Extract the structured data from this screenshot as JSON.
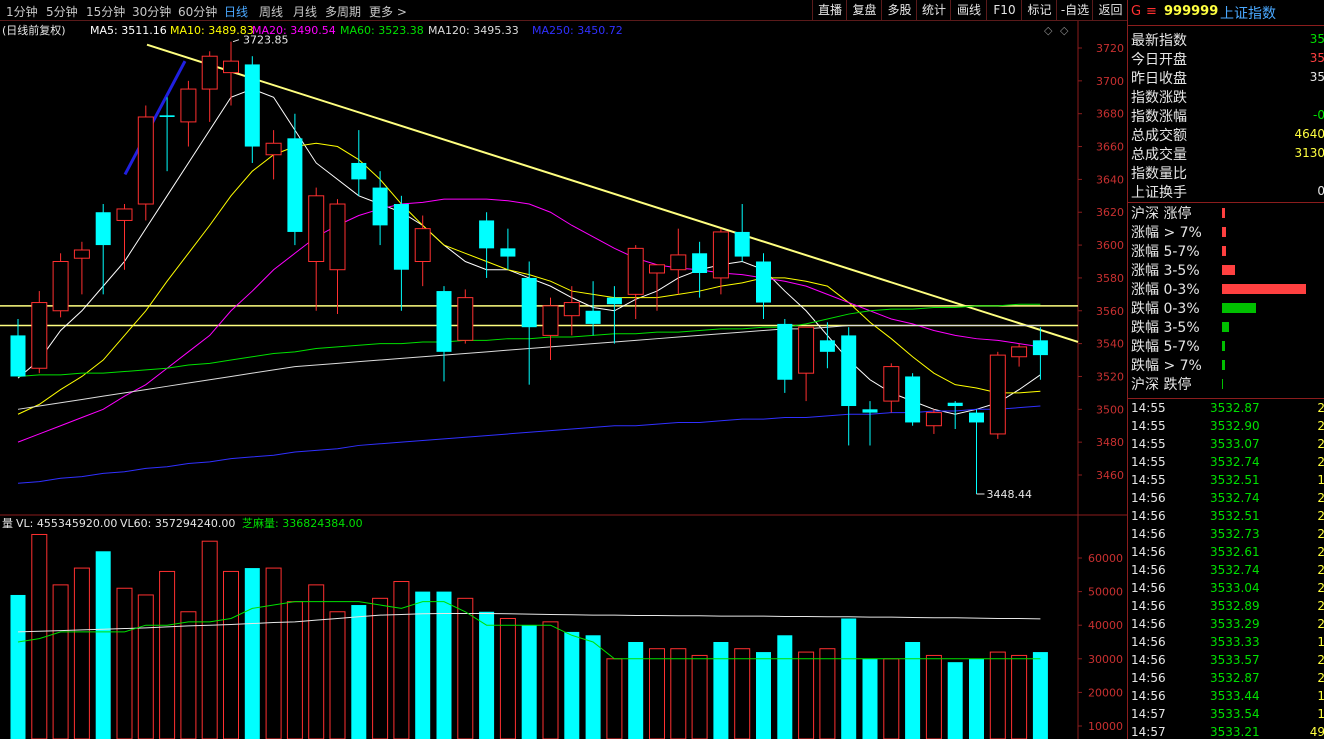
{
  "toolbar": {
    "periods": [
      "1分钟",
      "5分钟",
      "15分钟",
      "30分钟",
      "60分钟",
      "日线",
      "周线",
      "月线",
      "多周期",
      "更多 >"
    ],
    "active_period": "日线",
    "buttons": [
      "直播",
      "复盘",
      "多股",
      "统计",
      "画线",
      "F10",
      "标记",
      "-自选",
      "返回"
    ]
  },
  "ma_legend": {
    "mode": "(日线前复权)",
    "items": [
      {
        "text": "MA5: 3511.16",
        "color": "#ffffff"
      },
      {
        "text": "MA10: 3489.83",
        "color": "#ffff00"
      },
      {
        "text": "MA20: 3490.54",
        "color": "#ff00ff"
      },
      {
        "text": "MA60: 3523.38",
        "color": "#00e000"
      },
      {
        "text": "MA120: 3495.33",
        "color": "#dcdcdc"
      },
      {
        "text": "MA250: 3450.72",
        "color": "#3030ff"
      }
    ]
  },
  "volume_legend": {
    "title": "量",
    "items": [
      {
        "text": "VL: 455345920.00",
        "color": "#e6e6e6"
      },
      {
        "text": "VL60: 357294240.00",
        "color": "#e6e6e6"
      },
      {
        "text": "芝麻量: 336824384.00",
        "color": "#00e000"
      }
    ]
  },
  "chart_data": {
    "type": "candlestick",
    "price_axis": {
      "ticks": [
        3460,
        3480,
        3500,
        3520,
        3540,
        3560,
        3580,
        3600,
        3620,
        3640,
        3660,
        3680,
        3700,
        3720
      ]
    },
    "volume_axis": {
      "ticks": [
        10000,
        20000,
        30000,
        40000,
        50000,
        60000
      ]
    },
    "annotations": {
      "high_label": "3723.85",
      "low_label": "3448.44"
    },
    "candles": [
      {
        "o": 3545,
        "h": 3555,
        "l": 3525,
        "c": 3520
      },
      {
        "o": 3525,
        "h": 3572,
        "l": 3522,
        "c": 3565
      },
      {
        "o": 3560,
        "h": 3595,
        "l": 3556,
        "c": 3590
      },
      {
        "o": 3592,
        "h": 3602,
        "l": 3570,
        "c": 3597
      },
      {
        "o": 3620,
        "h": 3625,
        "l": 3570,
        "c": 3600
      },
      {
        "o": 3615,
        "h": 3625,
        "l": 3585,
        "c": 3622
      },
      {
        "o": 3625,
        "h": 3685,
        "l": 3615,
        "c": 3678
      },
      {
        "o": 3679,
        "h": 3690,
        "l": 3645,
        "c": 3678
      },
      {
        "o": 3675,
        "h": 3700,
        "l": 3660,
        "c": 3695
      },
      {
        "o": 3695,
        "h": 3718,
        "l": 3675,
        "c": 3715
      },
      {
        "o": 3705,
        "h": 3723.85,
        "l": 3685,
        "c": 3712
      },
      {
        "o": 3710,
        "h": 3715,
        "l": 3650,
        "c": 3660
      },
      {
        "o": 3655,
        "h": 3670,
        "l": 3640,
        "c": 3662
      },
      {
        "o": 3665,
        "h": 3680,
        "l": 3600,
        "c": 3608
      },
      {
        "o": 3590,
        "h": 3635,
        "l": 3560,
        "c": 3630
      },
      {
        "o": 3585,
        "h": 3628,
        "l": 3558,
        "c": 3625
      },
      {
        "o": 3650,
        "h": 3670,
        "l": 3630,
        "c": 3640
      },
      {
        "o": 3635,
        "h": 3645,
        "l": 3600,
        "c": 3612
      },
      {
        "o": 3625,
        "h": 3630,
        "l": 3560,
        "c": 3585
      },
      {
        "o": 3590,
        "h": 3618,
        "l": 3575,
        "c": 3610
      },
      {
        "o": 3572,
        "h": 3575,
        "l": 3517,
        "c": 3535
      },
      {
        "o": 3542,
        "h": 3573,
        "l": 3540,
        "c": 3568
      },
      {
        "o": 3615,
        "h": 3620,
        "l": 3580,
        "c": 3598
      },
      {
        "o": 3598,
        "h": 3610,
        "l": 3585,
        "c": 3593
      },
      {
        "o": 3580,
        "h": 3590,
        "l": 3515,
        "c": 3550
      },
      {
        "o": 3545,
        "h": 3568,
        "l": 3530,
        "c": 3563
      },
      {
        "o": 3557,
        "h": 3575,
        "l": 3545,
        "c": 3565
      },
      {
        "o": 3560,
        "h": 3578,
        "l": 3545,
        "c": 3552
      },
      {
        "o": 3568,
        "h": 3575,
        "l": 3540,
        "c": 3564
      },
      {
        "o": 3570,
        "h": 3600,
        "l": 3555,
        "c": 3598
      },
      {
        "o": 3583,
        "h": 3585,
        "l": 3560,
        "c": 3588
      },
      {
        "o": 3585,
        "h": 3610,
        "l": 3570,
        "c": 3594
      },
      {
        "o": 3595,
        "h": 3602,
        "l": 3568,
        "c": 3583
      },
      {
        "o": 3580,
        "h": 3610,
        "l": 3570,
        "c": 3608
      },
      {
        "o": 3608,
        "h": 3625,
        "l": 3590,
        "c": 3593
      },
      {
        "o": 3590,
        "h": 3595,
        "l": 3555,
        "c": 3565
      },
      {
        "o": 3552,
        "h": 3555,
        "l": 3510,
        "c": 3518
      },
      {
        "o": 3522,
        "h": 3550,
        "l": 3505,
        "c": 3550
      },
      {
        "o": 3542,
        "h": 3553,
        "l": 3525,
        "c": 3535
      },
      {
        "o": 3545,
        "h": 3550,
        "l": 3478,
        "c": 3502
      },
      {
        "o": 3500,
        "h": 3505,
        "l": 3478,
        "c": 3498
      },
      {
        "o": 3505,
        "h": 3528,
        "l": 3498,
        "c": 3526
      },
      {
        "o": 3520,
        "h": 3522,
        "l": 3490,
        "c": 3492
      },
      {
        "o": 3490,
        "h": 3500,
        "l": 3485,
        "c": 3498
      },
      {
        "o": 3504,
        "h": 3505,
        "l": 3488,
        "c": 3502
      },
      {
        "o": 3498,
        "h": 3500,
        "l": 3448.44,
        "c": 3492
      },
      {
        "o": 3485,
        "h": 3535,
        "l": 3482,
        "c": 3533
      },
      {
        "o": 3532,
        "h": 3540,
        "l": 3526,
        "c": 3538
      },
      {
        "o": 3542,
        "h": 3550,
        "l": 3518,
        "c": 3533
      }
    ],
    "volumes": [
      {
        "v": 49000,
        "up": false
      },
      {
        "v": 67000,
        "up": true
      },
      {
        "v": 52000,
        "up": true
      },
      {
        "v": 57000,
        "up": true
      },
      {
        "v": 62000,
        "up": false
      },
      {
        "v": 51000,
        "up": true
      },
      {
        "v": 49000,
        "up": true
      },
      {
        "v": 56000,
        "up": true
      },
      {
        "v": 44000,
        "up": true
      },
      {
        "v": 65000,
        "up": true
      },
      {
        "v": 56000,
        "up": true
      },
      {
        "v": 57000,
        "up": false
      },
      {
        "v": 57000,
        "up": true
      },
      {
        "v": 47000,
        "up": true
      },
      {
        "v": 52000,
        "up": true
      },
      {
        "v": 44000,
        "up": true
      },
      {
        "v": 46000,
        "up": false
      },
      {
        "v": 48000,
        "up": true
      },
      {
        "v": 53000,
        "up": true
      },
      {
        "v": 50000,
        "up": false
      },
      {
        "v": 50000,
        "up": false
      },
      {
        "v": 48000,
        "up": true
      },
      {
        "v": 44000,
        "up": false
      },
      {
        "v": 42000,
        "up": true
      },
      {
        "v": 40000,
        "up": false
      },
      {
        "v": 41000,
        "up": true
      },
      {
        "v": 38000,
        "up": false
      },
      {
        "v": 37000,
        "up": false
      },
      {
        "v": 30000,
        "up": true
      },
      {
        "v": 35000,
        "up": false
      },
      {
        "v": 33000,
        "up": true
      },
      {
        "v": 33000,
        "up": true
      },
      {
        "v": 31000,
        "up": true
      },
      {
        "v": 35000,
        "up": false
      },
      {
        "v": 33000,
        "up": true
      },
      {
        "v": 32000,
        "up": false
      },
      {
        "v": 37000,
        "up": false
      },
      {
        "v": 32000,
        "up": true
      },
      {
        "v": 33000,
        "up": true
      },
      {
        "v": 42000,
        "up": false
      },
      {
        "v": 30000,
        "up": false
      },
      {
        "v": 30000,
        "up": true
      },
      {
        "v": 35000,
        "up": false
      },
      {
        "v": 31000,
        "up": true
      },
      {
        "v": 29000,
        "up": false
      },
      {
        "v": 30000,
        "up": false
      },
      {
        "v": 32000,
        "up": true
      },
      {
        "v": 31000,
        "up": true
      },
      {
        "v": 32000,
        "up": false
      }
    ],
    "ma_lines": {
      "MA5": [
        3519,
        3530,
        3548,
        3560,
        3575,
        3590,
        3610,
        3630,
        3650,
        3670,
        3690,
        3695,
        3690,
        3670,
        3650,
        3640,
        3630,
        3625,
        3620,
        3612,
        3600,
        3590,
        3585,
        3585,
        3580,
        3575,
        3568,
        3562,
        3560,
        3567,
        3572,
        3580,
        3585,
        3588,
        3590,
        3585,
        3572,
        3560,
        3545,
        3530,
        3518,
        3510,
        3505,
        3500,
        3497,
        3500,
        3504,
        3512,
        3521
      ],
      "MA10": [
        3497,
        3503,
        3512,
        3520,
        3530,
        3545,
        3560,
        3578,
        3595,
        3612,
        3630,
        3645,
        3655,
        3660,
        3662,
        3660,
        3652,
        3640,
        3625,
        3612,
        3600,
        3595,
        3590,
        3585,
        3582,
        3578,
        3572,
        3570,
        3568,
        3568,
        3568,
        3570,
        3572,
        3575,
        3577,
        3580,
        3580,
        3578,
        3575,
        3565,
        3553,
        3543,
        3532,
        3522,
        3515,
        3513,
        3510,
        3510,
        3511
      ],
      "MA20": [
        3480,
        3485,
        3490,
        3495,
        3500,
        3508,
        3515,
        3525,
        3535,
        3545,
        3560,
        3572,
        3585,
        3595,
        3605,
        3612,
        3618,
        3622,
        3625,
        3626,
        3628,
        3628,
        3628,
        3627,
        3625,
        3620,
        3612,
        3605,
        3598,
        3592,
        3588,
        3586,
        3585,
        3583,
        3582,
        3580,
        3578,
        3575,
        3570,
        3565,
        3560,
        3555,
        3552,
        3548,
        3545,
        3543,
        3542,
        3540,
        3538
      ],
      "MA60": [
        3520,
        3521,
        3521,
        3522,
        3522,
        3523,
        3524,
        3525,
        3527,
        3528,
        3530,
        3532,
        3534,
        3535,
        3537,
        3538,
        3539,
        3540,
        3540,
        3541,
        3541,
        3542,
        3542,
        3543,
        3543,
        3544,
        3544,
        3545,
        3546,
        3546,
        3547,
        3547,
        3548,
        3549,
        3549,
        3550,
        3550,
        3552,
        3555,
        3558,
        3560,
        3561,
        3561,
        3562,
        3562,
        3563,
        3563,
        3564,
        3564
      ],
      "MA120": [
        3500,
        3502,
        3504,
        3506,
        3508,
        3510,
        3512,
        3514,
        3516,
        3518,
        3520,
        3522,
        3524,
        3526,
        3527,
        3528,
        3529,
        3530,
        3531,
        3532,
        3533,
        3534,
        3535,
        3536,
        3537,
        3538,
        3539,
        3540,
        3541,
        3542,
        3543,
        3544,
        3545,
        3546,
        3547,
        3548,
        3549,
        3549,
        3550,
        3551,
        3551,
        3551,
        3551,
        3551,
        3551,
        3551,
        3551,
        3551,
        3551
      ],
      "MA250": [
        3455,
        3456,
        3458,
        3459,
        3461,
        3462,
        3464,
        3465,
        3467,
        3468,
        3470,
        3471,
        3472,
        3474,
        3475,
        3476,
        3478,
        3479,
        3480,
        3481,
        3482,
        3483,
        3484,
        3485,
        3486,
        3487,
        3488,
        3489,
        3490,
        3490,
        3491,
        3492,
        3492,
        3493,
        3494,
        3494,
        3495,
        3495,
        3496,
        3497,
        3497,
        3498,
        3498,
        3499,
        3499,
        3500,
        3500,
        3501,
        3502
      ]
    },
    "volume_ma": {
      "VL60": [
        38000,
        38200,
        38400,
        38600,
        38800,
        39000,
        39200,
        39500,
        39800,
        40000,
        40200,
        40500,
        40800,
        41000,
        41500,
        42000,
        42500,
        43000,
        43200,
        43400,
        43500,
        43500,
        43500,
        43400,
        43300,
        43200,
        43100,
        43000,
        43000,
        42900,
        42900,
        42800,
        42800,
        42700,
        42700,
        42700,
        42600,
        42600,
        42500,
        42500,
        42400,
        42400,
        42300,
        42200,
        42200,
        42100,
        42000,
        42000,
        41900
      ],
      "芝麻量": [
        35000,
        36000,
        38000,
        38000,
        38000,
        38000,
        40000,
        40000,
        41000,
        41000,
        42000,
        45000,
        46000,
        47000,
        47000,
        47000,
        47000,
        46000,
        45000,
        47000,
        47000,
        44000,
        40000,
        40000,
        40000,
        40000,
        37000,
        35000,
        30000,
        30000,
        30000,
        30000,
        30000,
        30000,
        30000,
        30000,
        30000,
        30000,
        30000,
        30000,
        30000,
        30000,
        30000,
        30000,
        30000,
        30000,
        30000,
        30000,
        30000
      ]
    }
  },
  "sidebar": {
    "code": "999999",
    "name": "上证指数",
    "flag": "G",
    "menu_icon": "menu-icon",
    "quotes": [
      {
        "label": "最新指数",
        "value": "35",
        "color": "#00e000"
      },
      {
        "label": "今日开盘",
        "value": "35",
        "color": "#ff4040"
      },
      {
        "label": "昨日收盘",
        "value": "35",
        "color": "#e6e6e6"
      },
      {
        "label": "指数涨跌",
        "value": "",
        "color": "#00e000"
      },
      {
        "label": "指数涨幅",
        "value": "-0",
        "color": "#00e000"
      },
      {
        "label": "总成交额",
        "value": "4640",
        "color": "#ffff40"
      },
      {
        "label": "总成交量",
        "value": "3130",
        "color": "#ffff40"
      },
      {
        "label": "指数量比",
        "value": "",
        "color": "#e6e6e6"
      },
      {
        "label": "上证换手",
        "value": "0",
        "color": "#e6e6e6"
      }
    ],
    "distribution": [
      {
        "label": "沪深 涨停",
        "pct": 3,
        "color": "#ff4040"
      },
      {
        "label": "涨幅 > 7%",
        "pct": 5,
        "color": "#ff4040"
      },
      {
        "label": "涨幅 5-7%",
        "pct": 5,
        "color": "#ff4040"
      },
      {
        "label": "涨幅 3-5%",
        "pct": 16,
        "color": "#ff4040"
      },
      {
        "label": "涨幅 0-3%",
        "pct": 100,
        "color": "#ff4040"
      },
      {
        "label": "跌幅 0-3%",
        "pct": 40,
        "color": "#00c000"
      },
      {
        "label": "跌幅 3-5%",
        "pct": 8,
        "color": "#00c000"
      },
      {
        "label": "跌幅 5-7%",
        "pct": 4,
        "color": "#00c000"
      },
      {
        "label": "跌幅 > 7%",
        "pct": 3,
        "color": "#00c000"
      },
      {
        "label": "沪深 跌停",
        "pct": 1,
        "color": "#00c000"
      }
    ],
    "ticks": [
      {
        "time": "14:55",
        "price": "3532.87",
        "vol": "2"
      },
      {
        "time": "14:55",
        "price": "3532.90",
        "vol": "2"
      },
      {
        "time": "14:55",
        "price": "3533.07",
        "vol": "2"
      },
      {
        "time": "14:55",
        "price": "3532.74",
        "vol": "2"
      },
      {
        "time": "14:55",
        "price": "3532.51",
        "vol": "1"
      },
      {
        "time": "14:56",
        "price": "3532.74",
        "vol": "2"
      },
      {
        "time": "14:56",
        "price": "3532.51",
        "vol": "2"
      },
      {
        "time": "14:56",
        "price": "3532.73",
        "vol": "2"
      },
      {
        "time": "14:56",
        "price": "3532.61",
        "vol": "2"
      },
      {
        "time": "14:56",
        "price": "3532.74",
        "vol": "2"
      },
      {
        "time": "14:56",
        "price": "3533.04",
        "vol": "2"
      },
      {
        "time": "14:56",
        "price": "3532.89",
        "vol": "2"
      },
      {
        "time": "14:56",
        "price": "3533.29",
        "vol": "2"
      },
      {
        "time": "14:56",
        "price": "3533.33",
        "vol": "1"
      },
      {
        "time": "14:56",
        "price": "3533.57",
        "vol": "2"
      },
      {
        "time": "14:56",
        "price": "3532.87",
        "vol": "2"
      },
      {
        "time": "14:56",
        "price": "3533.44",
        "vol": "1"
      },
      {
        "time": "14:57",
        "price": "3533.54",
        "vol": "1"
      },
      {
        "time": "14:57",
        "price": "3533.21",
        "vol": "49"
      }
    ]
  }
}
